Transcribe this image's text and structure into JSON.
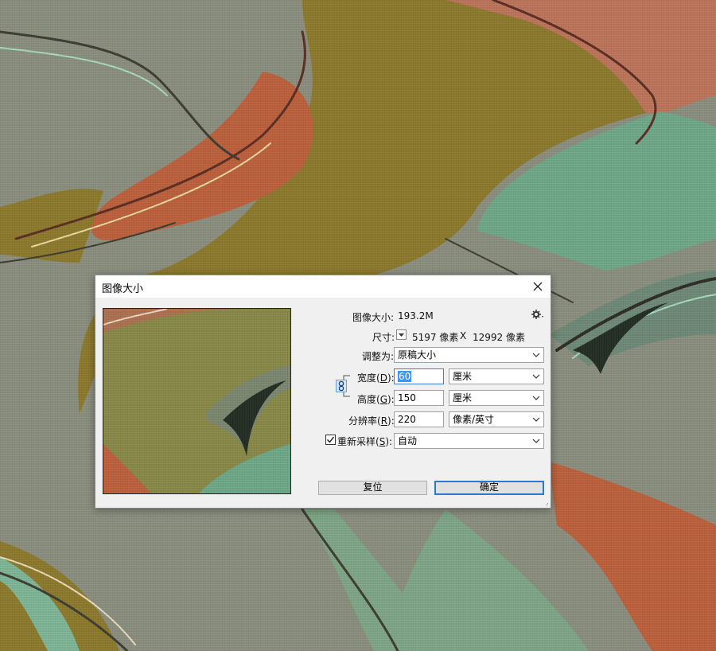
{
  "dialog": {
    "title": "图像大小",
    "image_size_label": "图像大小:",
    "image_size_value": "193.2M",
    "dimensions_label": "尺寸:",
    "dim_width": "5197 像素",
    "dim_x": "X",
    "dim_height": "12992 像素",
    "fit_to_label": "调整为:",
    "fit_to_value": "原稿大小",
    "width_label_pre": "宽度(",
    "width_label_key": "D",
    "width_label_post": "):",
    "width_value": "60",
    "width_unit": "厘米",
    "height_label_pre": "高度(",
    "height_label_key": "G",
    "height_label_post": "):",
    "height_value": "150",
    "height_unit": "厘米",
    "resolution_label_pre": "分辨率(",
    "resolution_label_key": "R",
    "resolution_label_post": "):",
    "resolution_value": "220",
    "resolution_unit": "像素/英寸",
    "resample_label_pre": "重新采样(",
    "resample_label_key": "S",
    "resample_label_post": "):",
    "resample_checked": true,
    "resample_value": "自动",
    "reset_button": "复位",
    "ok_button": "确定"
  },
  "icons": {
    "close": "close-icon",
    "settings": "gear-icon",
    "dimensions_menu": "triangle-down-icon",
    "constrain": "chain-link-icon",
    "dropdown": "chevron-down-icon",
    "checkbox": "checkmark-icon"
  },
  "colors": {
    "accent": "#2b78d6",
    "selection": "#3399ff",
    "dialog_bg": "#f0f0f0"
  }
}
